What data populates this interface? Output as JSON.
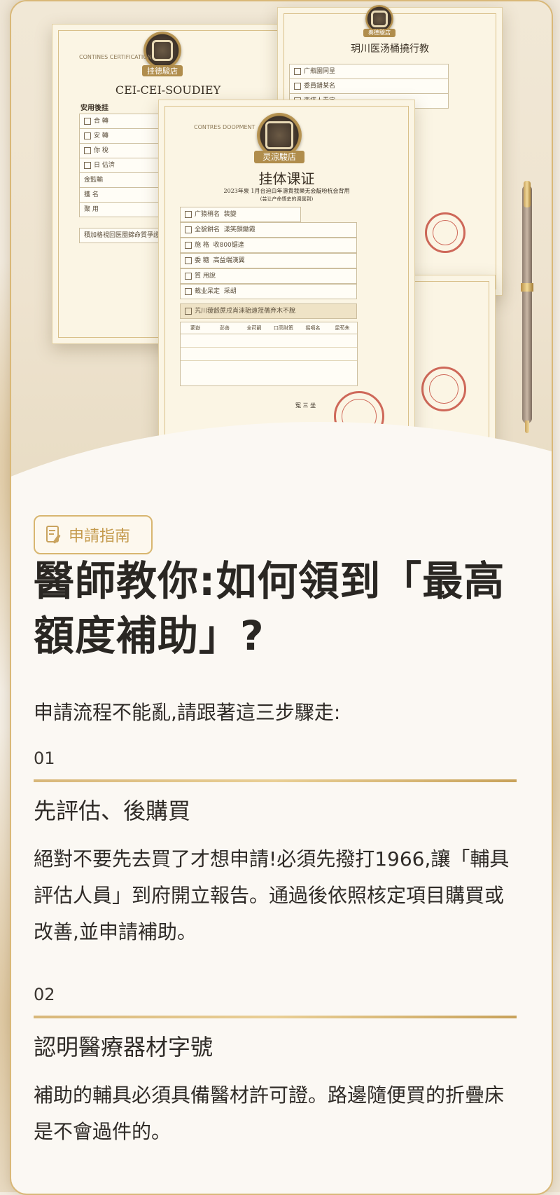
{
  "hero": {
    "doc_left_title": "CEI-CEI-SOUDIEY",
    "doc_left_brand": "CONTINES CERTIFICATION",
    "doc_left_seal_label": "挂德駿店",
    "doc_left_section": "安用後挂",
    "doc_left_rows": [
      "合  轉",
      "安  轉",
      "你  稅",
      "日  估済",
      "金監輸",
      "獲  名",
      "聚  用"
    ],
    "doc_left_footer": "積加格視回医圈錦命質爭證",
    "doc_right_title": "玥川医汤桶撓行教",
    "doc_right_seal_label": "奏德駿店",
    "doc_right_rows": [
      "广瓶園同呈",
      "委員錯某名",
      "变塔人責定"
    ],
    "doc_main_brand": "CONTRES DOOPMENT",
    "doc_main_seal_label": "灵淙駿店",
    "doc_main_title": "挂体课证",
    "doc_main_subtitle": "2023年泉 1月台迫白年濤貴我樂无会靛吩杭会背用",
    "doc_main_subsubtitle": "(芸让产命悟史的调属到)",
    "doc_main_rows": [
      {
        "label": "广猿梢名",
        "value": "装變"
      },
      {
        "label": "全貌餠名",
        "value": "漾笑顔鋤霞"
      },
      {
        "label": "施    格",
        "value": "收800锯達"
      },
      {
        "label": "委    糖",
        "value": "高益端漢翼"
      },
      {
        "label": "質    用說",
        "value": ""
      },
      {
        "label": "裁业呆定",
        "value": "采胡"
      }
    ],
    "doc_main_notice": "艽川菝瞉蔗戌肖涞骀遠蒞蒨弃木不脫",
    "doc_main_table_headers": [
      "蒙嶽",
      "彭善",
      "全莳嗣",
      "口高財策",
      "摇嗝名",
      "昆苟朱"
    ],
    "doc_main_sign": "冤 三 坐"
  },
  "guide_badge": {
    "label": "申請指南",
    "icon": "document-edit-icon"
  },
  "headline": "醫師教你:如何領到「最高額度補助」?",
  "intro": "申請流程不能亂,請跟著這三步驟走:",
  "steps": [
    {
      "number": "01",
      "title": "先評估、後購買",
      "body": "絕對不要先去買了才想申請!必須先撥打1966,讓「輔具評估人員」到府開立報告。通過後依照核定項目購買或改善,並申請補助。"
    },
    {
      "number": "02",
      "title": "認明醫療器材字號",
      "body": "補助的輔具必須具備醫材許可證。路邊隨便買的折疊床是不會過件的。"
    }
  ],
  "colors": {
    "accent_gold": "#c9a35e",
    "text_dark": "#2a2723",
    "stamp_red": "#c0392b"
  }
}
